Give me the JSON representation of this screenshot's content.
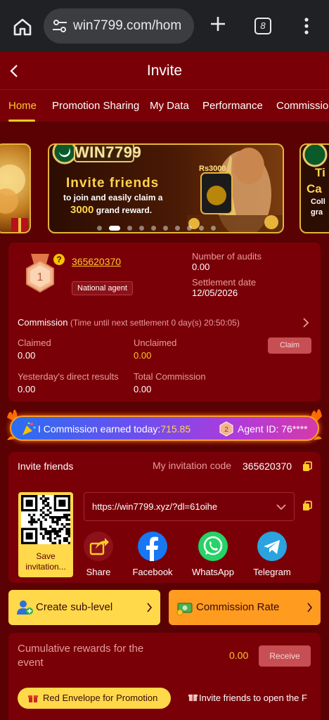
{
  "browser": {
    "url": "win7799.com/hom",
    "tab_count": "8"
  },
  "header": {
    "title": "Invite"
  },
  "tabs": [
    {
      "label": "Home",
      "active": true
    },
    {
      "label": "Promotion Sharing"
    },
    {
      "label": "My Data"
    },
    {
      "label": "Performance"
    },
    {
      "label": "Commission"
    }
  ],
  "banner": {
    "brand": "WIN7799",
    "heading": "Invite friends",
    "line1": "to join and easily claim a",
    "amount": "3000",
    "line2_suffix": " grand reward.",
    "badge": "Rs3000",
    "peek_right_1": "Ti",
    "peek_right_2": "Ca",
    "peek_right_3": "Coll",
    "peek_right_4": "gra",
    "dot_count": 10,
    "active_dot": 1
  },
  "agent": {
    "level": "1",
    "help": "?",
    "id": "365620370",
    "badge": "National agent",
    "audits_label": "Number of audits",
    "audits_value": "0.00",
    "settlement_label": "Settlement date",
    "settlement_value": "12/05/2026"
  },
  "commission": {
    "title": "Commission",
    "countdown": " (Time until next settlement 0 day(s) 20:50:05)",
    "claimed_label": "Claimed",
    "claimed_value": "0.00",
    "unclaimed_label": "Unclaimed",
    "unclaimed_value": "0.00",
    "claim_button": "Claim",
    "yesterday_label": "Yesterday's direct results",
    "yesterday_value": "0.00",
    "total_label": "Total Commission",
    "total_value": "0.00"
  },
  "strip": {
    "earned_label": "I Commission earned today:",
    "earned_value": "715.85",
    "agent_label": "Agent ID: 76****",
    "badge_num": "2"
  },
  "invite": {
    "title": "Invite friends",
    "code_label": "My invitation code",
    "code_value": "365620370",
    "qr_label": "Save invitation...",
    "link": "https://win7799.xyz/?dl=61oihe",
    "share": [
      {
        "label": "Share",
        "icon": "share-icon"
      },
      {
        "label": "Facebook",
        "icon": "facebook-icon",
        "color": "#1877f2"
      },
      {
        "label": "WhatsApp",
        "icon": "whatsapp-icon",
        "color": "#25d366"
      },
      {
        "label": "Telegram",
        "icon": "telegram-icon",
        "color": "#2aa3df"
      }
    ]
  },
  "actions": {
    "sub_level": "Create sub-level",
    "commission_rate": "Commission Rate"
  },
  "rewards": {
    "label": "Cumulative rewards for the event",
    "value": "0.00",
    "receive_button": "Receive",
    "red_envelope": "Red Envelope for Promotion",
    "invite_open": "Invite friends to open the F"
  },
  "colors": {
    "background": "#5a0104",
    "card": "#7a0008",
    "accent": "#ffc928",
    "button_yellow": "#ffd94a",
    "button_orange": "#ff9b1f"
  }
}
